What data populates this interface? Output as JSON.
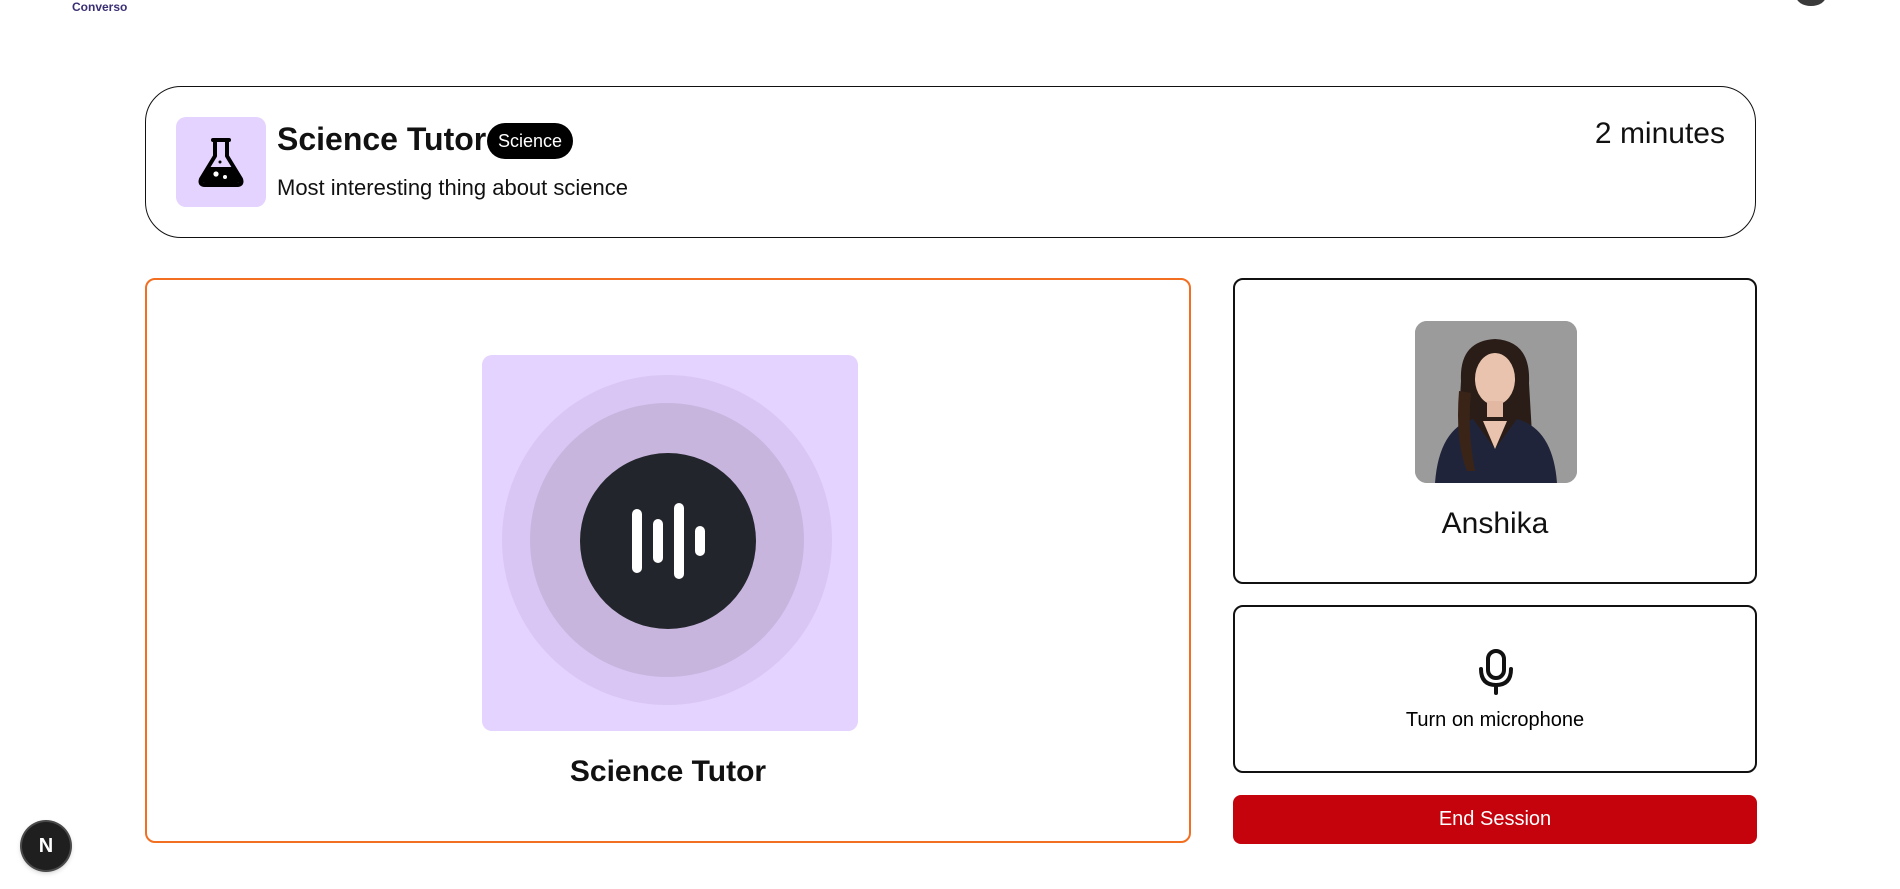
{
  "app": {
    "brand": "Converso"
  },
  "companion": {
    "name": "Science Tutor",
    "subject": "Science",
    "topic": "Most interesting thing about science",
    "duration": "2 minutes",
    "subject_icon": "flask-icon",
    "accent_color": "#e4d2ff"
  },
  "session": {
    "tutor_label": "Science Tutor",
    "user_name": "Anshika",
    "mic_label": "Turn on microphone",
    "end_label": "End Session",
    "panel_border_color": "#f26f21",
    "end_button_color": "#c4030c"
  },
  "dev_badge": {
    "letter": "N"
  }
}
